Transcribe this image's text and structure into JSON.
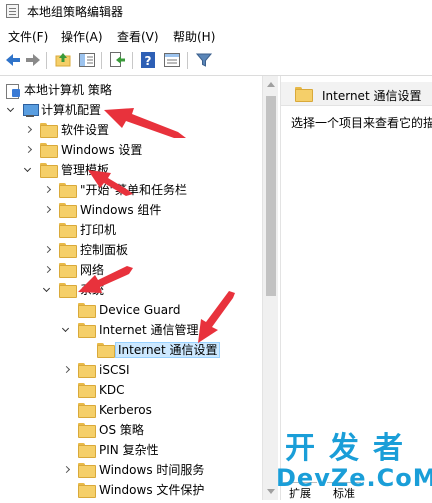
{
  "window": {
    "title": "本地组策略编辑器"
  },
  "menu": [
    "文件(F)",
    "操作(A)",
    "查看(V)",
    "帮助(H)"
  ],
  "toolbar": {
    "icons": [
      "back-arrow-icon",
      "forward-arrow-icon",
      "up-folder-icon",
      "show-hide-tree-icon",
      "export-list-icon",
      "help-icon",
      "properties-icon",
      "filter-icon"
    ]
  },
  "tree": [
    {
      "label": "本地计算机 策略",
      "icon": "policy"
    },
    {
      "label": "计算机配置",
      "icon": "computer"
    },
    {
      "label": "软件设置",
      "icon": "folder"
    },
    {
      "label": "Windows 设置",
      "icon": "folder"
    },
    {
      "label": "管理模板",
      "icon": "folder"
    },
    {
      "label": "\"开始\"菜单和任务栏",
      "icon": "folder"
    },
    {
      "label": "Windows 组件",
      "icon": "folder"
    },
    {
      "label": "打印机",
      "icon": "folder"
    },
    {
      "label": "控制面板",
      "icon": "folder"
    },
    {
      "label": "网络",
      "icon": "folder"
    },
    {
      "label": "系统",
      "icon": "folder"
    },
    {
      "label": "Device Guard",
      "icon": "folder"
    },
    {
      "label": "Internet 通信管理",
      "icon": "folder"
    },
    {
      "label": "Internet 通信设置",
      "icon": "folder",
      "selected": true
    },
    {
      "label": "iSCSI",
      "icon": "folder"
    },
    {
      "label": "KDC",
      "icon": "folder"
    },
    {
      "label": "Kerberos",
      "icon": "folder"
    },
    {
      "label": "OS 策略",
      "icon": "folder"
    },
    {
      "label": "PIN 复杂性",
      "icon": "folder"
    },
    {
      "label": "Windows 时间服务",
      "icon": "folder"
    },
    {
      "label": "Windows 文件保护",
      "icon": "folder"
    }
  ],
  "right_pane": {
    "header": "Internet 通信设置",
    "description": "选择一个项目来查看它的描",
    "tabs": [
      "扩展",
      "标准"
    ]
  },
  "watermark": {
    "line1": "开发者",
    "line2": "DevZe.CoM"
  },
  "colors": {
    "selection": "#cce8ff",
    "annotation_arrow": "#e8323c",
    "watermark": "#1a9ed8"
  }
}
